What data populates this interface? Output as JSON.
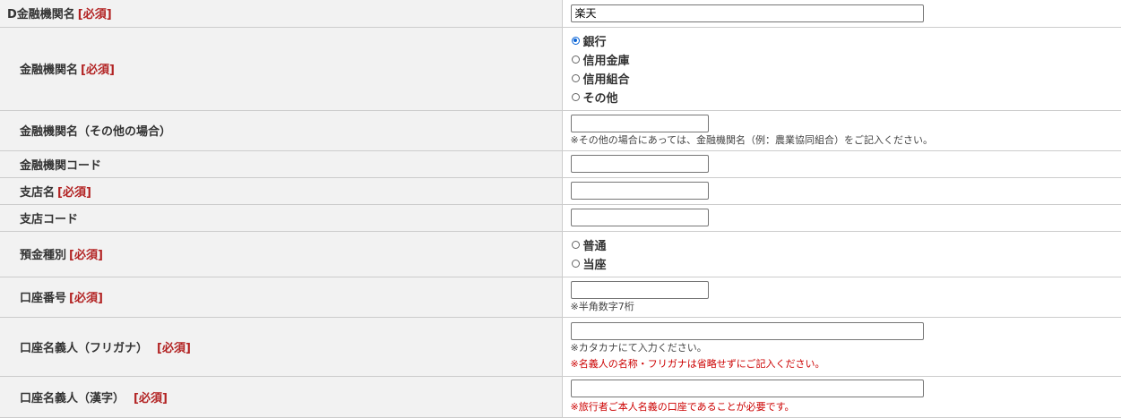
{
  "required_tag": "[必須]",
  "rows": {
    "bank_name_d": {
      "label": "D金融機関名",
      "value": "楽天"
    },
    "bank_type": {
      "label": "金融機関名",
      "options": [
        "銀行",
        "信用金庫",
        "信用組合",
        "その他"
      ],
      "selected": "銀行"
    },
    "bank_other": {
      "label": "金融機関名（その他の場合）",
      "value": "",
      "note": "※その他の場合にあっては、金融機関名（例：農業協同組合）をご記入ください。"
    },
    "bank_code": {
      "label": "金融機関コード",
      "value": ""
    },
    "branch_name": {
      "label": "支店名",
      "value": ""
    },
    "branch_code": {
      "label": "支店コード",
      "value": ""
    },
    "deposit_type": {
      "label": "預金種別",
      "options": [
        "普通",
        "当座"
      ],
      "selected": ""
    },
    "account_number": {
      "label": "口座番号",
      "value": "",
      "note": "※半角数字7桁"
    },
    "holder_kana": {
      "label": "口座名義人（フリガナ）",
      "value": "",
      "note": "※カタカナにて入力ください。",
      "warning": "※名義人の名称・フリガナは省略せずにご記入ください。"
    },
    "holder_kanji": {
      "label": "口座名義人（漢字）",
      "value": "",
      "warning": "※旅行者ご本人名義の口座であることが必要です。"
    }
  },
  "colors": {
    "label_bg": "#f2f2f2",
    "required": "#b22222",
    "warning": "#cc0000",
    "radio_accent": "#0a64d6"
  }
}
